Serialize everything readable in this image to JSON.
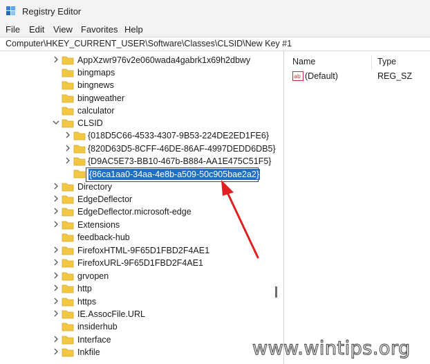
{
  "window": {
    "title": "Registry Editor"
  },
  "menu": [
    "File",
    "Edit",
    "View",
    "Favorites",
    "Help"
  ],
  "address": "Computer\\HKEY_CURRENT_USER\\Software\\Classes\\CLSID\\New Key #1",
  "tree": [
    "AppXzwr976v2e060wada4gabrk1x69h2dbwy",
    "bingmaps",
    "bingnews",
    "bingweather",
    "calculator",
    "CLSID",
    "{018D5C66-4533-4307-9B53-224DE2ED1FE6}",
    "{820D63D5-8CFF-46DE-86AF-4997DEDD6DB5}",
    "{D9AC5E73-BB10-467b-B884-AA1E475C51F5}",
    "",
    "Directory",
    "EdgeDeflector",
    "EdgeDeflector.microsoft-edge",
    "Extensions",
    "feedback-hub",
    "FirefoxHTML-9F65D1FBD2F4AE1",
    "FirefoxURL-9F65D1FBD2F4AE1",
    "grvopen",
    "http",
    "https",
    "IE.AssocFile.URL",
    "insiderhub",
    "Interface",
    "Inkfile"
  ],
  "rename_value": "{86ca1aa0-34aa-4e8b-a509-50c905bae2a2}",
  "list": {
    "col_name": "Name",
    "col_type": "Type",
    "rows": [
      {
        "name": "(Default)",
        "type": "REG_SZ"
      }
    ]
  },
  "watermark": "www.wintips.org",
  "colors": {
    "selection": "#1f6fc5",
    "arrow": "#e02020",
    "folder": "#f2c744"
  }
}
